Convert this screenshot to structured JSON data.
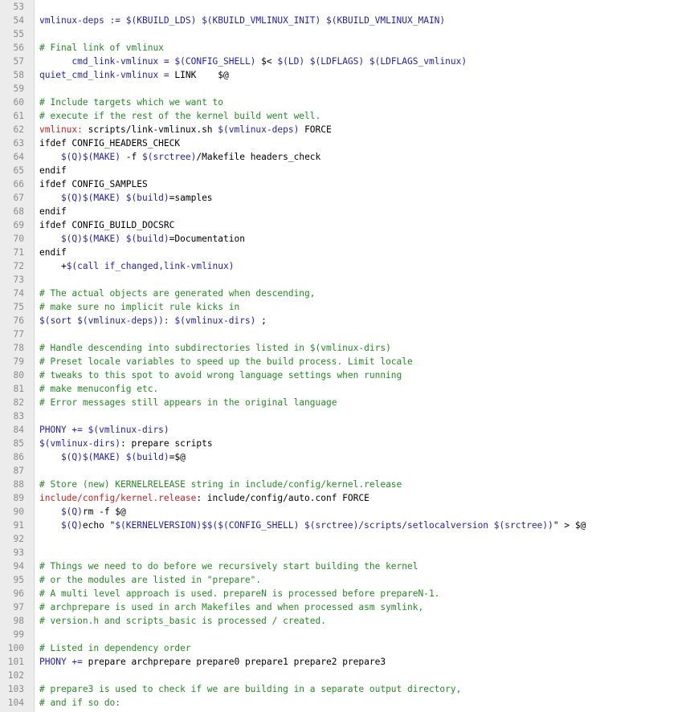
{
  "colors": {
    "comment": "#228b22",
    "variable": "#1f1fb4",
    "target": "#cc1f1f",
    "plain": "#000000",
    "line_number": "#8a8a8a",
    "gutter_bg": "#ececec"
  },
  "code_lines": [
    {
      "n": "53",
      "segs": []
    },
    {
      "n": "54",
      "segs": [
        [
          "var",
          "vmlinux-deps := $(KBUILD_LDS) $(KBUILD_VMLINUX_INIT) $(KBUILD_VMLINUX_MAIN)"
        ]
      ]
    },
    {
      "n": "55",
      "segs": []
    },
    {
      "n": "56",
      "segs": [
        [
          "comment",
          "# Final link of vmlinux"
        ]
      ]
    },
    {
      "n": "57",
      "segs": [
        [
          "var",
          "      cmd_link-vmlinux = $(CONFIG_SHELL) "
        ],
        [
          "plain",
          "$< "
        ],
        [
          "var",
          "$(LD) $(LDFLAGS) $(LDFLAGS_vmlinux)"
        ]
      ]
    },
    {
      "n": "58",
      "segs": [
        [
          "var",
          "quiet_cmd_link-vmlinux = "
        ],
        [
          "plain",
          "LINK    $@"
        ]
      ]
    },
    {
      "n": "59",
      "segs": []
    },
    {
      "n": "60",
      "segs": [
        [
          "comment",
          "# Include targets which we want to"
        ]
      ]
    },
    {
      "n": "61",
      "segs": [
        [
          "comment",
          "# execute if the rest of the kernel build went well."
        ]
      ]
    },
    {
      "n": "62",
      "segs": [
        [
          "target",
          "vmlinux:"
        ],
        [
          "plain",
          " scripts/link-vmlinux.sh "
        ],
        [
          "var",
          "$(vmlinux-deps)"
        ],
        [
          "plain",
          " FORCE"
        ]
      ]
    },
    {
      "n": "63",
      "segs": [
        [
          "plain",
          "ifdef CONFIG_HEADERS_CHECK"
        ]
      ]
    },
    {
      "n": "64",
      "segs": [
        [
          "var",
          "    $(Q)$(MAKE)"
        ],
        [
          "plain",
          " -f "
        ],
        [
          "var",
          "$(srctree)"
        ],
        [
          "plain",
          "/Makefile headers_check"
        ]
      ]
    },
    {
      "n": "65",
      "segs": [
        [
          "plain",
          "endif"
        ]
      ]
    },
    {
      "n": "66",
      "segs": [
        [
          "plain",
          "ifdef CONFIG_SAMPLES"
        ]
      ]
    },
    {
      "n": "67",
      "segs": [
        [
          "var",
          "    $(Q)$(MAKE) $(build)"
        ],
        [
          "plain",
          "=samples"
        ]
      ]
    },
    {
      "n": "68",
      "segs": [
        [
          "plain",
          "endif"
        ]
      ]
    },
    {
      "n": "69",
      "segs": [
        [
          "plain",
          "ifdef CONFIG_BUILD_DOCSRC"
        ]
      ]
    },
    {
      "n": "70",
      "segs": [
        [
          "var",
          "    $(Q)$(MAKE) $(build)"
        ],
        [
          "plain",
          "=Documentation"
        ]
      ]
    },
    {
      "n": "71",
      "segs": [
        [
          "plain",
          "endif"
        ]
      ]
    },
    {
      "n": "72",
      "segs": [
        [
          "plain",
          "    +"
        ],
        [
          "var",
          "$(call if_changed,link-vmlinux)"
        ]
      ]
    },
    {
      "n": "73",
      "segs": []
    },
    {
      "n": "74",
      "segs": [
        [
          "comment",
          "# The actual objects are generated when descending,"
        ]
      ]
    },
    {
      "n": "75",
      "segs": [
        [
          "comment",
          "# make sure no implicit rule kicks in"
        ]
      ]
    },
    {
      "n": "76",
      "segs": [
        [
          "var",
          "$(sort $(vmlinux-deps)): $(vmlinux-dirs)"
        ],
        [
          "plain",
          " ;"
        ]
      ]
    },
    {
      "n": "77",
      "segs": []
    },
    {
      "n": "78",
      "segs": [
        [
          "comment",
          "# Handle descending into subdirectories listed in $(vmlinux-dirs)"
        ]
      ]
    },
    {
      "n": "79",
      "segs": [
        [
          "comment",
          "# Preset locale variables to speed up the build process. Limit locale"
        ]
      ]
    },
    {
      "n": "80",
      "segs": [
        [
          "comment",
          "# tweaks to this spot to avoid wrong language settings when running"
        ]
      ]
    },
    {
      "n": "81",
      "segs": [
        [
          "comment",
          "# make menuconfig etc."
        ]
      ]
    },
    {
      "n": "82",
      "segs": [
        [
          "comment",
          "# Error messages still appears in the original language"
        ]
      ]
    },
    {
      "n": "83",
      "segs": []
    },
    {
      "n": "84",
      "segs": [
        [
          "var",
          "PHONY += $(vmlinux-dirs)"
        ]
      ]
    },
    {
      "n": "85",
      "segs": [
        [
          "var",
          "$(vmlinux-dirs)"
        ],
        [
          "plain",
          ": prepare scripts"
        ]
      ]
    },
    {
      "n": "86",
      "segs": [
        [
          "var",
          "    $(Q)$(MAKE) $(build)"
        ],
        [
          "plain",
          "=$@"
        ]
      ]
    },
    {
      "n": "87",
      "segs": []
    },
    {
      "n": "88",
      "segs": [
        [
          "comment",
          "# Store (new) KERNELRELEASE string in include/config/kernel.release"
        ]
      ]
    },
    {
      "n": "89",
      "segs": [
        [
          "target",
          "include/config/kernel.release"
        ],
        [
          "plain",
          ": include/config/auto.conf FORCE"
        ]
      ]
    },
    {
      "n": "90",
      "segs": [
        [
          "var",
          "    $(Q)"
        ],
        [
          "plain",
          "rm -f $@"
        ]
      ]
    },
    {
      "n": "91",
      "segs": [
        [
          "var",
          "    $(Q)"
        ],
        [
          "plain",
          "echo \""
        ],
        [
          "var",
          "$(KERNELVERSION)$$($(CONFIG_SHELL) $(srctree)/scripts/setlocalversion $(srctree))"
        ],
        [
          "plain",
          "\" > $@"
        ]
      ]
    },
    {
      "n": "92",
      "segs": []
    },
    {
      "n": "93",
      "segs": []
    },
    {
      "n": "94",
      "segs": [
        [
          "comment",
          "# Things we need to do before we recursively start building the kernel"
        ]
      ]
    },
    {
      "n": "95",
      "segs": [
        [
          "comment",
          "# or the modules are listed in \"prepare\"."
        ]
      ]
    },
    {
      "n": "96",
      "segs": [
        [
          "comment",
          "# A multi level approach is used. prepareN is processed before prepareN-1."
        ]
      ]
    },
    {
      "n": "97",
      "segs": [
        [
          "comment",
          "# archprepare is used in arch Makefiles and when processed asm symlink,"
        ]
      ]
    },
    {
      "n": "98",
      "segs": [
        [
          "comment",
          "# version.h and scripts_basic is processed / created."
        ]
      ]
    },
    {
      "n": "99",
      "segs": []
    },
    {
      "n": "100",
      "segs": [
        [
          "comment",
          "# Listed in dependency order"
        ]
      ]
    },
    {
      "n": "101",
      "segs": [
        [
          "var",
          "PHONY += "
        ],
        [
          "plain",
          "prepare archprepare prepare0 prepare1 prepare2 prepare3"
        ]
      ]
    },
    {
      "n": "102",
      "segs": []
    },
    {
      "n": "103",
      "segs": [
        [
          "comment",
          "# prepare3 is used to check if we are building in a separate output directory,"
        ]
      ]
    },
    {
      "n": "104",
      "segs": [
        [
          "comment",
          "# and if so do:"
        ]
      ]
    }
  ]
}
